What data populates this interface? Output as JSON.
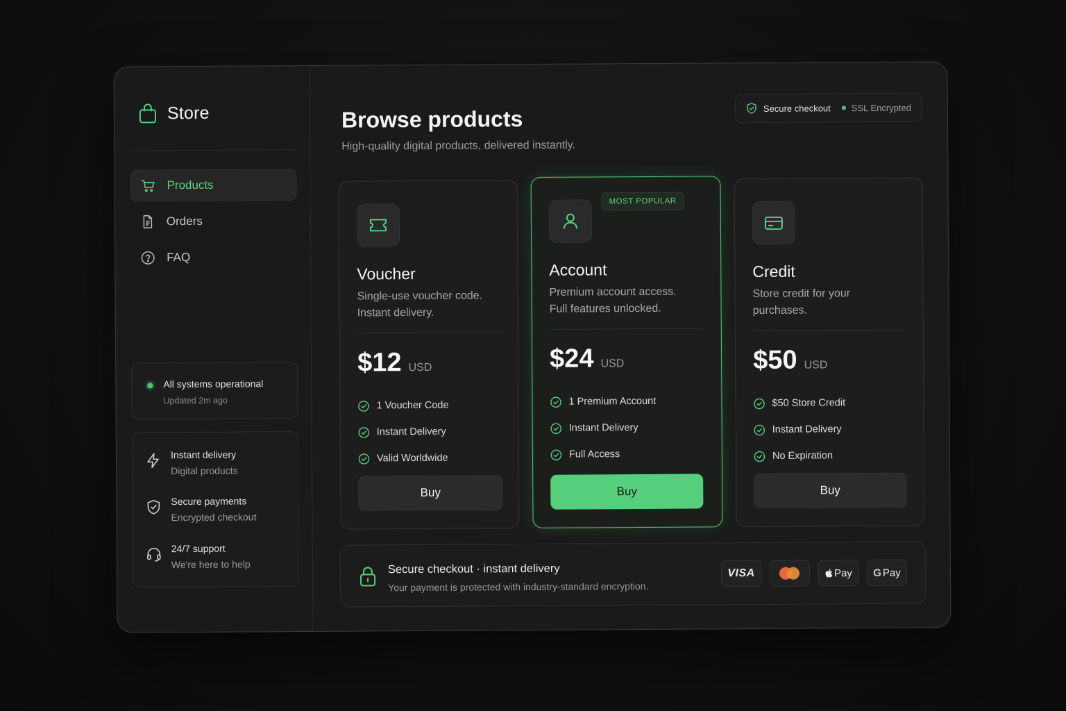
{
  "brand": {
    "name": "Store"
  },
  "nav": {
    "items": [
      {
        "label": "Products",
        "icon": "cart-icon",
        "active": true
      },
      {
        "label": "Orders",
        "icon": "document-icon",
        "active": false
      },
      {
        "label": "FAQ",
        "icon": "question-circle-icon",
        "active": false
      }
    ]
  },
  "status": {
    "title": "All systems operational",
    "updated": "Updated 2m ago"
  },
  "features": [
    {
      "title": "Instant delivery",
      "subtitle": "Digital products",
      "icon": "lightning-icon"
    },
    {
      "title": "Secure payments",
      "subtitle": "Encrypted checkout",
      "icon": "shield-check-icon"
    },
    {
      "title": "24/7 support",
      "subtitle": "We're here to help",
      "icon": "headset-icon"
    }
  ],
  "header": {
    "title": "Browse products",
    "subtitle": "High-quality digital products, delivered instantly.",
    "secure_label": "Secure checkout",
    "ssl_label": "SSL Encrypted"
  },
  "products": [
    {
      "name": "Voucher",
      "desc": "Single-use voucher code. Instant delivery.",
      "price": "$12",
      "currency": "USD",
      "features": [
        "1 Voucher Code",
        "Instant Delivery",
        "Valid Worldwide"
      ],
      "button": "Buy",
      "icon": "ticket-icon"
    },
    {
      "name": "Account",
      "desc": "Premium account access. Full features unlocked.",
      "price": "$24",
      "currency": "USD",
      "badge": "MOST POPULAR",
      "features": [
        "1 Premium Account",
        "Instant Delivery",
        "Full Access"
      ],
      "button": "Buy",
      "icon": "user-icon"
    },
    {
      "name": "Credit",
      "desc": "Store credit for your purchases.",
      "price": "$50",
      "currency": "USD",
      "features": [
        "$50 Store Credit",
        "Instant Delivery",
        "No Expiration"
      ],
      "button": "Buy",
      "icon": "credit-card-icon"
    }
  ],
  "checkout": {
    "title": "Secure checkout · instant delivery",
    "subtitle": "Your payment is protected with industry-standard encryption.",
    "payments": {
      "visa": "VISA",
      "applepay": "Pay",
      "googlepay_g": "G",
      "googlepay": "Pay"
    }
  },
  "colors": {
    "accent": "#56cf7d",
    "background": "#1a1a1a",
    "card": "#1d1d1d"
  }
}
